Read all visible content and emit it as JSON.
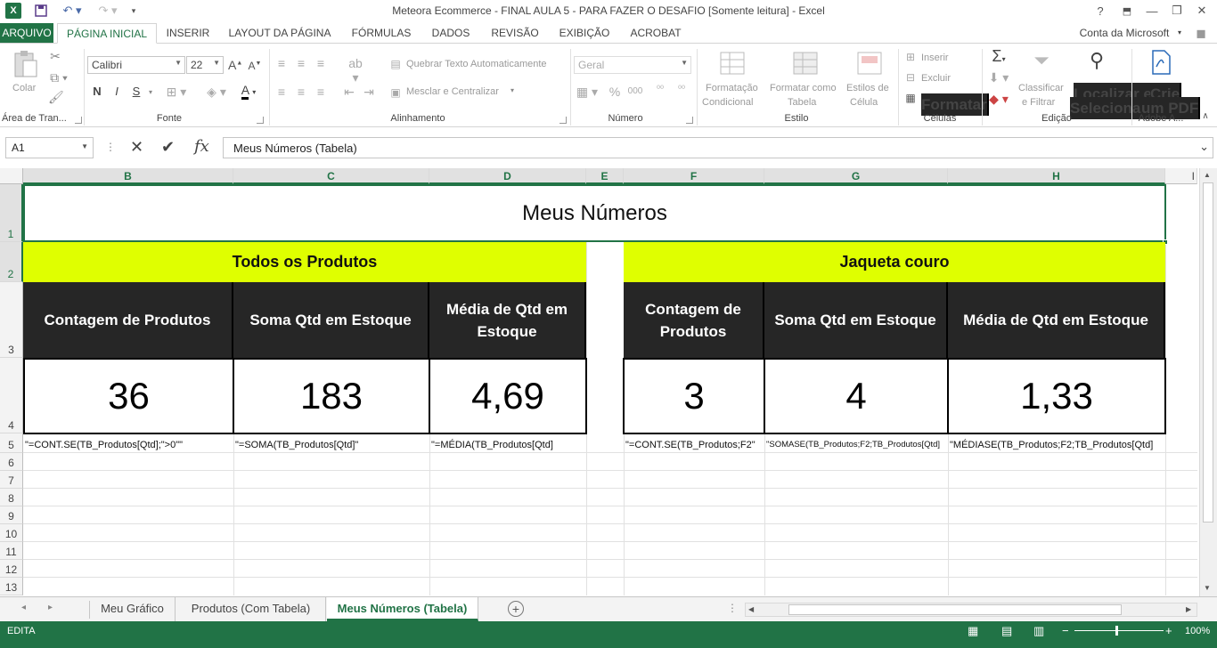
{
  "titlebar": {
    "title": "Meteora Ecommerce - FINAL AULA 5 - PARA FAZER O DESAFIO  [Somente leitura] - Excel",
    "help": "?",
    "minimize": "—",
    "restore": "❐",
    "close": "✕"
  },
  "tabs": [
    "ARQUIVO",
    "PÁGINA INICIAL",
    "INSERIR",
    "LAYOUT DA PÁGINA",
    "FÓRMULAS",
    "DADOS",
    "REVISÃO",
    "EXIBIÇÃO",
    "ACROBAT"
  ],
  "account": "Conta da Microsoft",
  "ribbon": {
    "clipboard": {
      "paste": "Colar",
      "label": "Área de Tran..."
    },
    "font": {
      "name": "Calibri",
      "size": "22",
      "bold": "N",
      "italic": "I",
      "underline": "S",
      "label": "Fonte"
    },
    "alignment": {
      "wrap": "Quebrar Texto Automaticamente",
      "merge": "Mesclar e Centralizar",
      "label": "Alinhamento"
    },
    "number": {
      "format": "Geral",
      "percent": "%",
      "thousands": "000",
      "label": "Número"
    },
    "styles": {
      "conditional_1": "Formatação",
      "conditional_2": "Condicional",
      "table_1": "Formatar como",
      "table_2": "Tabela",
      "cell_1": "Estilos de",
      "cell_2": "Célula",
      "label": "Estilo"
    },
    "cells": {
      "insert": "Inserir",
      "delete": "Excluir",
      "format": "Formatar",
      "label": "Células"
    },
    "editing": {
      "sort_1": "Classificar",
      "sort_2": "e Filtrar",
      "find_1": "Localizar e",
      "find_2": "Selecionar",
      "label": "Edição"
    },
    "adobe": {
      "pdf_1": "Crie",
      "pdf_2": "um PDF",
      "label": "Adobe A..."
    }
  },
  "formula_bar": {
    "name_box": "A1",
    "fx": "fx",
    "content": "Meus Números (Tabela)"
  },
  "columns": [
    "B",
    "C",
    "D",
    "E",
    "F",
    "G",
    "H",
    "I"
  ],
  "rows": [
    "1",
    "2",
    "3",
    "4",
    "5",
    "6",
    "7",
    "8",
    "9",
    "10",
    "11",
    "12",
    "13"
  ],
  "sheet": {
    "title": "Meus Números",
    "left_section": {
      "header": "Todos os Produtos",
      "labels": [
        "Contagem de Produtos",
        "Soma Qtd em Estoque",
        "Média de Qtd em Estoque"
      ],
      "values": [
        "36",
        "183",
        "4,69"
      ],
      "formulas": [
        "\"=CONT.SE(TB_Produtos[Qtd];\">0\"\"",
        "\"=SOMA(TB_Produtos[Qtd]\"",
        "\"=MÉDIA(TB_Produtos[Qtd]"
      ]
    },
    "right_section": {
      "header": "Jaqueta couro",
      "labels": [
        "Contagem de Produtos",
        "Soma Qtd em Estoque",
        "Média de Qtd em Estoque"
      ],
      "values": [
        "3",
        "4",
        "1,33"
      ],
      "formulas": [
        "\"=CONT.SE(TB_Produtos;F2\"",
        "\"SOMASE(TB_Produtos;F2;TB_Produtos[Qtd]",
        "\"MÉDIASE(TB_Produtos;F2;TB_Produtos[Qtd]"
      ]
    }
  },
  "sheet_tabs": [
    "Meu Gráfico",
    "Produtos (Com Tabela)",
    "Meus Números (Tabela)"
  ],
  "status": {
    "mode": "EDITA",
    "zoom": "100%"
  },
  "colors": {
    "excel_green": "#217346",
    "highlight": "#dfff00",
    "header_dark": "#262626"
  }
}
